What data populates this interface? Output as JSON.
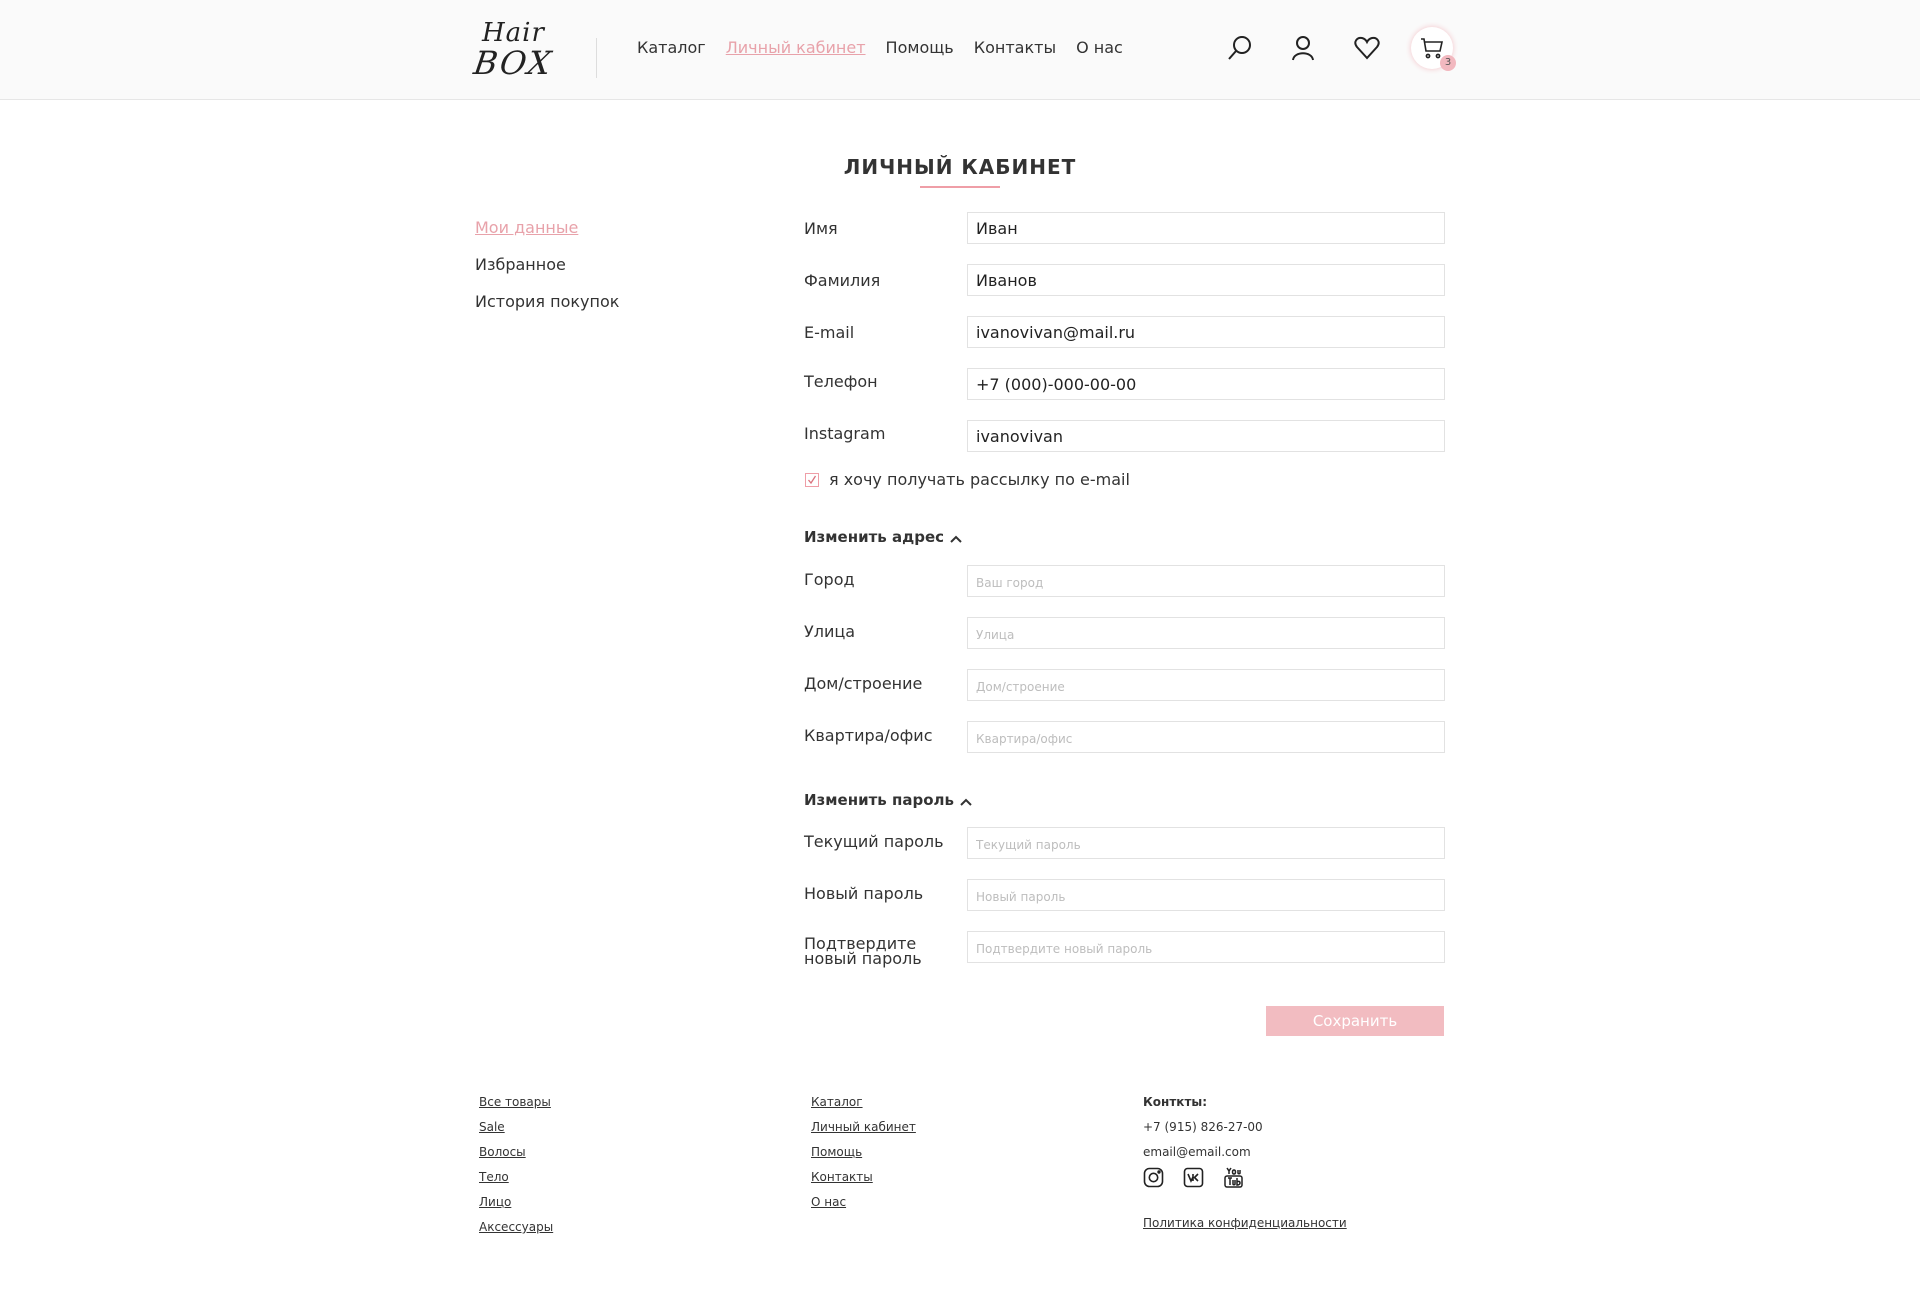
{
  "header": {
    "logo_line1": "Hair",
    "logo_line2": "BOX",
    "nav": [
      "Каталог",
      "Личный кабинет",
      "Помощь",
      "Контакты",
      "О нас"
    ],
    "cart_count": "3",
    "icons": [
      "search-icon",
      "user-icon",
      "heart-icon",
      "cart-icon"
    ]
  },
  "page": {
    "title": "ЛИЧНЫЙ КАБИНЕТ"
  },
  "sidebar": {
    "items": [
      "Мои данные",
      "Избранное",
      "История покупок"
    ]
  },
  "profile": {
    "fields": [
      {
        "label": "Имя",
        "value": "Иван"
      },
      {
        "label": "Фамилия",
        "value": "Иванов"
      },
      {
        "label": "E-mail",
        "value": "ivanovivan@mail.ru"
      },
      {
        "label": "Телефон",
        "value": "+7 (000)-000-00-00"
      },
      {
        "label": "Instagram",
        "value": "ivanovivan"
      }
    ],
    "newsletter_label": "я хочу получать рассылку по e-mail",
    "newsletter_checked": true
  },
  "address": {
    "heading": "Изменить адрес",
    "fields": [
      {
        "label": "Город",
        "placeholder": "Ваш город"
      },
      {
        "label": "Улица",
        "placeholder": "Улица"
      },
      {
        "label": "Дом/строение",
        "placeholder": "Дом/строение"
      },
      {
        "label": "Квартира/офис",
        "placeholder": "Квартира/офис"
      }
    ]
  },
  "password": {
    "heading": "Изменить пароль",
    "fields": [
      {
        "label": "Текущий пароль",
        "placeholder": "Текущий пароль"
      },
      {
        "label": "Новый пароль",
        "placeholder": "Новый пароль"
      },
      {
        "label_line1": "Подтвердите",
        "label_line2": "новый пароль",
        "placeholder": "Подтвердите новый пароль"
      }
    ]
  },
  "save_label": "Сохранить",
  "footer": {
    "col1": [
      "Все товары",
      "Sale",
      "Волосы",
      "Тело",
      "Лицо",
      "Аксессуары"
    ],
    "col2": [
      "Каталог",
      "Личный кабинет",
      "Помощь",
      "Контакты",
      "О нас"
    ],
    "contacts_heading": "Конткты:",
    "phone": "+7 (915) 826-27-00",
    "email": "email@email.com",
    "social_icons": [
      "instagram-icon",
      "vk-icon",
      "youtube-icon"
    ],
    "policy": "Политика конфиденциальности"
  },
  "colors": {
    "accent": "#e8a2aa",
    "button": "#f2bcc1"
  }
}
